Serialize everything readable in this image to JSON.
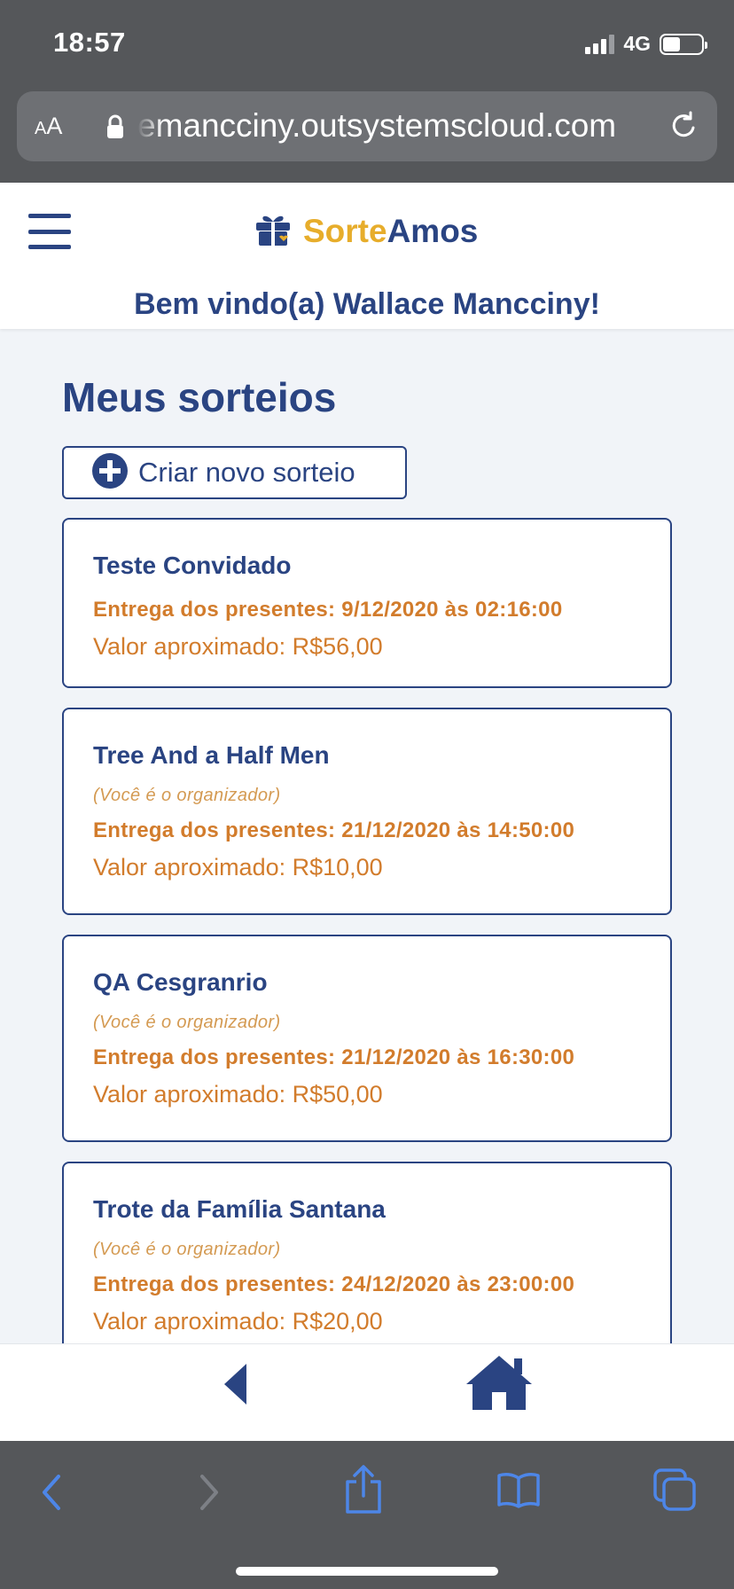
{
  "status_bar": {
    "time": "18:57",
    "network": "4G"
  },
  "browser": {
    "text_size_label_small": "A",
    "text_size_label_large": "A",
    "url": "emancciny.outsystemscloud.com"
  },
  "app": {
    "brand_part1": "Sorte",
    "brand_part2": "Amos",
    "welcome": "Bem vindo(a) Wallace Mancciny!"
  },
  "page": {
    "title": "Meus sorteios",
    "create_label": "Criar novo sorteio"
  },
  "draws": [
    {
      "title": "Teste Convidado",
      "organizer": "",
      "delivery": "Entrega dos presentes: 9/12/2020 às 02:16:00",
      "value": "Valor aproximado: R$56,00"
    },
    {
      "title": "Tree And a Half Men",
      "organizer": "(Você é o organizador)",
      "delivery": "Entrega dos presentes: 21/12/2020 às 14:50:00",
      "value": "Valor aproximado: R$10,00"
    },
    {
      "title": "QA Cesgranrio",
      "organizer": "(Você é o organizador)",
      "delivery": "Entrega dos presentes: 21/12/2020 às 16:30:00",
      "value": "Valor aproximado: R$50,00"
    },
    {
      "title": "Trote da Família Santana",
      "organizer": "(Você é o organizador)",
      "delivery": "Entrega dos presentes: 24/12/2020 às 23:00:00",
      "value": "Valor aproximado: R$20,00"
    }
  ],
  "icons": {
    "menu": "hamburger-icon",
    "brand": "gift-icon",
    "create": "plus-circle-icon",
    "back": "triangle-left-icon",
    "home": "home-icon",
    "safari": [
      "chevron-left-icon",
      "chevron-right-icon",
      "share-icon",
      "book-icon",
      "tabs-icon"
    ]
  },
  "colors": {
    "primary": "#2a4482",
    "brand_accent": "#e7ad2b",
    "orange": "#d27c2c",
    "safari_blue": "#4d86e8"
  }
}
